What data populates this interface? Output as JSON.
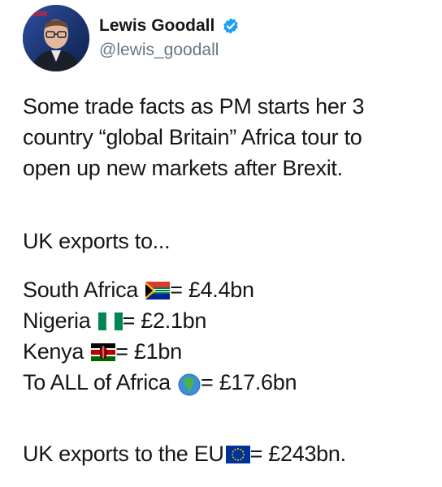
{
  "user": {
    "name": "Lewis Goodall",
    "handle": "@lewis_goodall"
  },
  "tweet": {
    "intro_lines": [
      "Some trade facts as PM starts her 3",
      "country “global Britain” Africa tour to",
      "open up new markets after Brexit."
    ],
    "exports_heading": "UK exports to...",
    "rows": [
      {
        "label": "South Africa",
        "flag": "south-africa-flag",
        "value": "= £4.4bn"
      },
      {
        "label": "Nigeria",
        "flag": "nigeria-flag",
        "value": "= £2.1bn"
      },
      {
        "label": "Kenya",
        "flag": "kenya-flag",
        "value": "= £1bn"
      },
      {
        "label": "To ALL of Africa",
        "flag": "globe-africa-icon",
        "value": "= £17.6bn"
      }
    ],
    "eu_label": "UK exports to the EU",
    "eu_flag": "eu-flag",
    "eu_value": "= £243bn."
  },
  "colors": {
    "text": "#14171a",
    "handle": "#657786",
    "verified": "#1da1f2"
  }
}
